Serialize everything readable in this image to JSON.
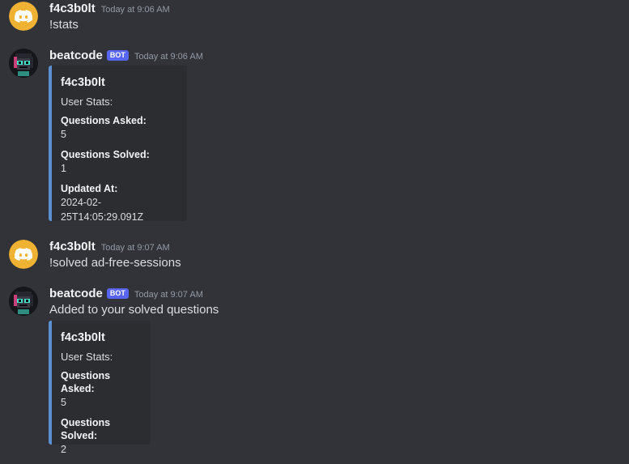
{
  "messages": [
    {
      "author": "f4c3b0lt",
      "timestamp": "Today at 9:06 AM",
      "text": "!stats"
    },
    {
      "author": "beatcode",
      "bot_tag": "BOT",
      "timestamp": "Today at 9:06 AM",
      "embed": {
        "title": "f4c3b0lt",
        "description": "User Stats:",
        "fields": [
          {
            "name": "Questions Asked:",
            "value": "5"
          },
          {
            "name": "Questions Solved:",
            "value": "1"
          },
          {
            "name": "Updated At:",
            "value": "2024-02-25T14:05:29.091Z"
          }
        ]
      }
    },
    {
      "author": "f4c3b0lt",
      "timestamp": "Today at 9:07 AM",
      "text": "!solved ad-free-sessions"
    },
    {
      "author": "beatcode",
      "bot_tag": "BOT",
      "timestamp": "Today at 9:07 AM",
      "text": "Added to your solved questions",
      "embed": {
        "title": "f4c3b0lt",
        "description": "User Stats:",
        "fields": [
          {
            "name": "Questions Asked:",
            "value": "5"
          },
          {
            "name": "Questions Solved:",
            "value": "2"
          }
        ]
      }
    }
  ],
  "colors": {
    "background": "#313338",
    "embed_background": "#2b2d31",
    "embed_border": "#5b8fd0",
    "bot_tag": "#5865f2",
    "discord_avatar": "#f0b232"
  },
  "icons": {
    "user_avatar": "discord-logo-icon",
    "bot_avatar": "pixel-character-icon"
  }
}
